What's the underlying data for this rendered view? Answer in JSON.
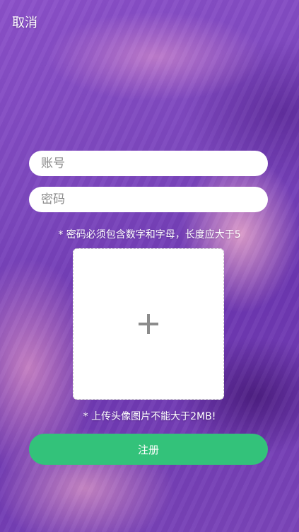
{
  "header": {
    "cancel_label": "取消"
  },
  "form": {
    "account_placeholder": "账号",
    "password_placeholder": "密码",
    "password_hint": "* 密码必须包含数字和字母，长度应大于5",
    "avatar_hint": "* 上传头像图片不能大于2MB!",
    "upload_icon": "plus-icon",
    "register_label": "注册"
  },
  "colors": {
    "register_button": "#33c27a",
    "background": "#7a45b5"
  }
}
